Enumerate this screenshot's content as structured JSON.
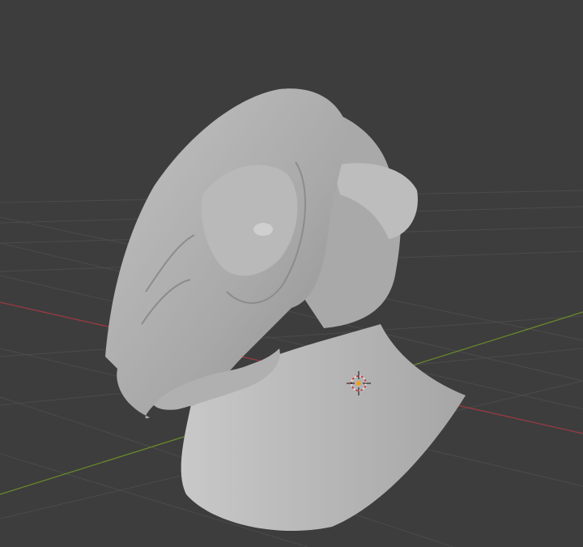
{
  "viewport": {
    "background_color": "#3d3d3d",
    "grid_color": "#4a4a4a",
    "x_axis_color": "#9a3a44",
    "y_axis_color": "#6a8a2a",
    "model_color": "#b4b4b4",
    "cursor_icon": "3d-cursor-icon"
  }
}
